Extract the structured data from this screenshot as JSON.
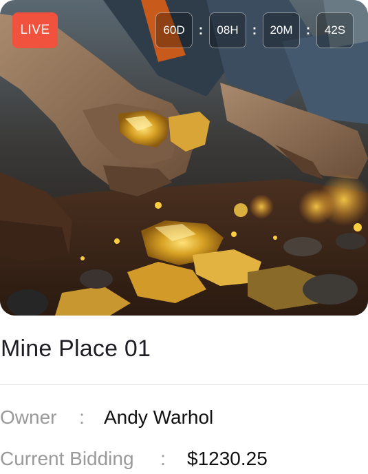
{
  "card": {
    "live_label": "LIVE",
    "countdown": {
      "days": "60D",
      "hours": "08H",
      "minutes": "20M",
      "seconds": "42S",
      "separator": ":"
    },
    "title": "Mine Place 01",
    "owner_label": "Owner",
    "owner_value": "Andy Warhol",
    "bid_label": "Current Bidding",
    "bid_value": "$1230.25",
    "colon": ":"
  },
  "colors": {
    "live_badge": "#f0523d",
    "title_text": "#1e1e24",
    "label_text": "#9a9a9a"
  }
}
